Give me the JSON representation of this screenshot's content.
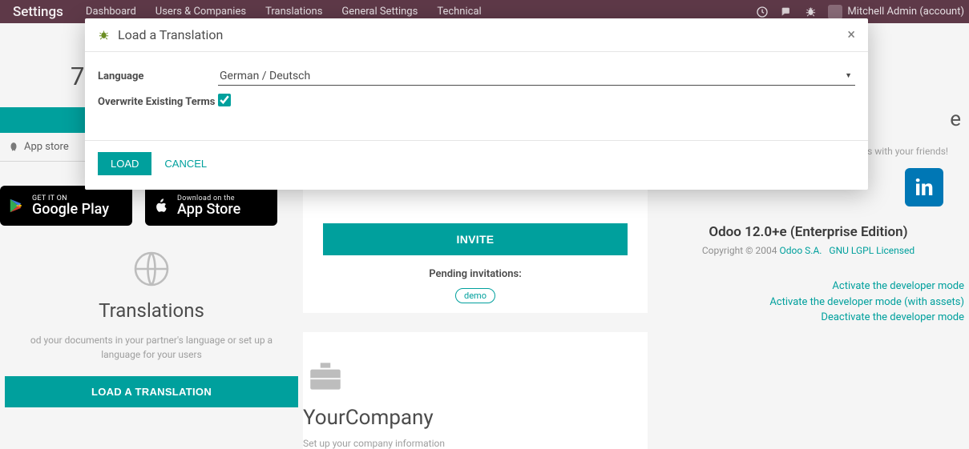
{
  "nav": {
    "brand": "Settings",
    "links": [
      "Dashboard",
      "Users & Companies",
      "Translations",
      "General Settings",
      "Technical"
    ],
    "user": "Mitchell Admin (account)"
  },
  "left": {
    "number": "7",
    "appstore": "App store",
    "google_small": "GET IT ON",
    "google_big": "Google Play",
    "apple_small": "Download on the",
    "apple_big": "App Store",
    "trans_title": "Translations",
    "trans_sub": "od your documents in your partner's language or set up a language for your users",
    "trans_btn": "LOAD A TRANSLATION"
  },
  "mid": {
    "invite": "INVITE",
    "pending": "Pending invitations:",
    "pill": "demo",
    "company_title": "YourCompany",
    "company_sub": "Set up your company information"
  },
  "right": {
    "letter": "e",
    "share_sub": "ess with your friends!",
    "linkedin": "in",
    "edition": "Odoo 12.0+e (Enterprise Edition)",
    "copyright_prefix": "Copyright © 2004 ",
    "odoo_link": "Odoo S.A.",
    "lgpl_link": "GNU LGPL Licensed",
    "dev1": "Activate the developer mode",
    "dev2": "Activate the developer mode (with assets)",
    "dev3": "Deactivate the developer mode"
  },
  "modal": {
    "title": "Load a Translation",
    "label_lang": "Language",
    "value_lang": "German / Deutsch",
    "label_overwrite": "Overwrite Existing Terms",
    "overwrite_checked": true,
    "btn_load": "LOAD",
    "btn_cancel": "CANCEL",
    "close": "×"
  }
}
